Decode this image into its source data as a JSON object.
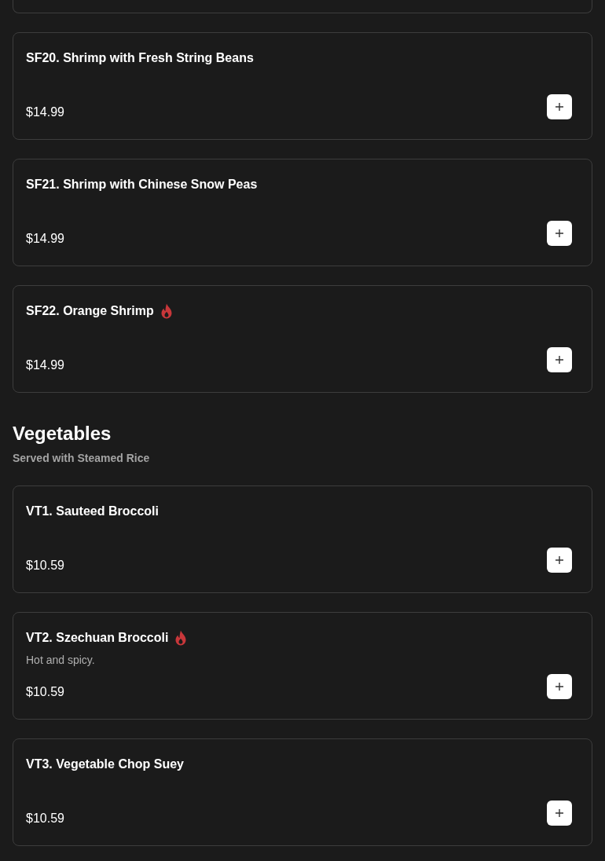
{
  "sections": [
    {
      "items": [
        {
          "name": "SF20. Shrimp with Fresh String Beans",
          "spicy": false,
          "price": "$14.99"
        },
        {
          "name": "SF21. Shrimp with Chinese Snow Peas",
          "spicy": false,
          "price": "$14.99"
        },
        {
          "name": "SF22. Orange Shrimp",
          "spicy": true,
          "price": "$14.99"
        }
      ]
    },
    {
      "title": "Vegetables",
      "subtitle": "Served with Steamed Rice",
      "items": [
        {
          "name": "VT1. Sauteed Broccoli",
          "spicy": false,
          "price": "$10.59"
        },
        {
          "name": "VT2. Szechuan Broccoli",
          "spicy": true,
          "description": "Hot and spicy.",
          "price": "$10.59"
        },
        {
          "name": "VT3. Vegetable Chop Suey",
          "spicy": false,
          "price": "$10.59"
        }
      ]
    }
  ]
}
